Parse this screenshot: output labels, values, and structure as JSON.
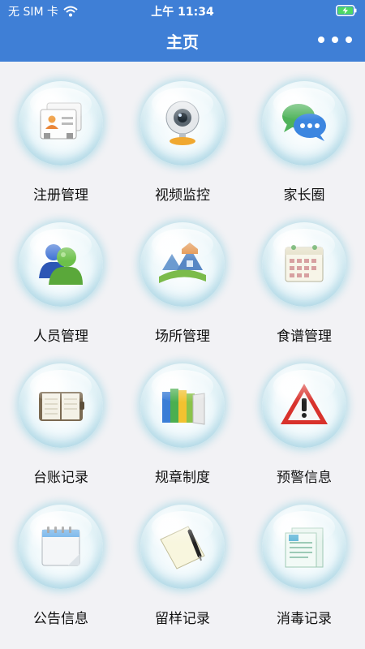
{
  "status_bar": {
    "carrier": "无 SIM 卡",
    "time": "上午 11:34"
  },
  "header": {
    "title": "主页"
  },
  "colors": {
    "header_bg": "#3f7fd6",
    "page_bg": "#f2f2f5"
  },
  "menu": [
    {
      "label": "注册管理",
      "icon": "id-card-icon"
    },
    {
      "label": "视频监控",
      "icon": "webcam-icon"
    },
    {
      "label": "家长圈",
      "icon": "chat-bubbles-icon"
    },
    {
      "label": "人员管理",
      "icon": "people-icon"
    },
    {
      "label": "场所管理",
      "icon": "house-icon"
    },
    {
      "label": "食谱管理",
      "icon": "calendar-icon"
    },
    {
      "label": "台账记录",
      "icon": "planner-book-icon"
    },
    {
      "label": "规章制度",
      "icon": "binders-icon"
    },
    {
      "label": "预警信息",
      "icon": "warning-icon"
    },
    {
      "label": "公告信息",
      "icon": "notepad-icon"
    },
    {
      "label": "留样记录",
      "icon": "notebook-pen-icon"
    },
    {
      "label": "消毒记录",
      "icon": "document-icon"
    }
  ]
}
